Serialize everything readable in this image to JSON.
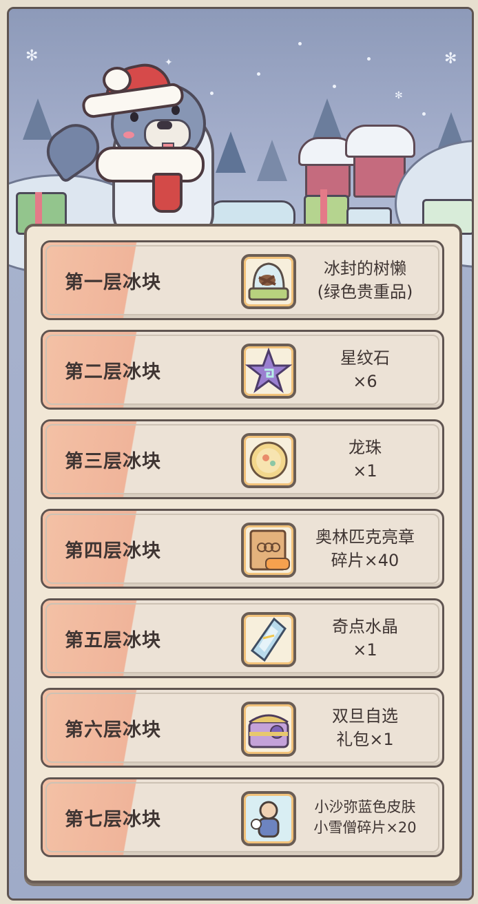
{
  "rewards": [
    {
      "layer": "第一层冰块",
      "name_line1": "冰封的树懒",
      "name_line2": "(绿色贵重品)",
      "icon": "frozen-sloth-icon"
    },
    {
      "layer": "第二层冰块",
      "name_line1": "星纹石",
      "name_line2": "×6",
      "icon": "star-stone-icon"
    },
    {
      "layer": "第三层冰块",
      "name_line1": "龙珠",
      "name_line2": "×1",
      "icon": "dragon-pearl-icon"
    },
    {
      "layer": "第四层冰块",
      "name_line1": "奥林匹克亮章",
      "name_line2": "碎片×40",
      "icon": "olympic-badge-fragment-icon"
    },
    {
      "layer": "第五层冰块",
      "name_line1": "奇点水晶",
      "name_line2": "×1",
      "icon": "singularity-crystal-icon"
    },
    {
      "layer": "第六层冰块",
      "name_line1": "双旦自选",
      "name_line2": "礼包×1",
      "icon": "gift-pack-icon"
    },
    {
      "layer": "第七层冰块",
      "name_line1": "小沙弥蓝色皮肤",
      "name_line2": "小雪僧碎片×20",
      "icon": "monk-skin-icon"
    }
  ],
  "colors": {
    "panel_bg": "#f1e7d6",
    "row_stripe": "#f0b49a",
    "text": "#3f3533",
    "sky": "#a4aecb"
  }
}
